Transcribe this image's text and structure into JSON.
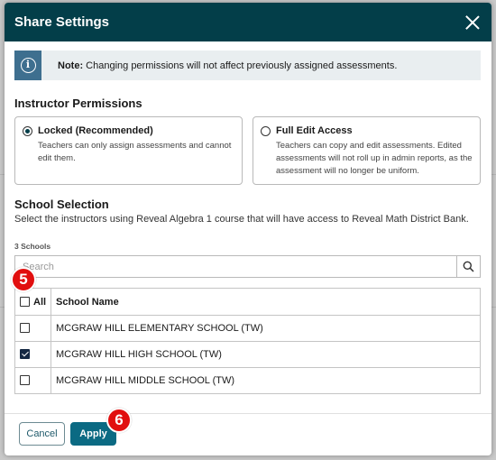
{
  "dialog": {
    "title": "Share Settings"
  },
  "note": {
    "label": "Note:",
    "text": " Changing permissions will not affect previously assigned assessments."
  },
  "instructor_permissions": {
    "heading": "Instructor Permissions",
    "options": [
      {
        "label": "Locked (Recommended)",
        "description_lines": [
          "Teachers can only assign assessments and cannot",
          "edit them."
        ],
        "selected": true
      },
      {
        "label": "Full Edit Access",
        "description_lines": [
          "Teachers can copy and edit assessments. Edited",
          "assessments will not roll up in admin reports, as the",
          "assessment will no longer be uniform."
        ],
        "selected": false
      }
    ]
  },
  "school_selection": {
    "heading": "School Selection",
    "description": "Select the instructors using Reveal Algebra 1 course that will have access to Reveal Math District Bank.",
    "count_label": "3 Schools",
    "search_placeholder": "Search",
    "table": {
      "all_label": "All",
      "column_header": "School Name",
      "rows": [
        {
          "name": "MCGRAW HILL ELEMENTARY SCHOOL (TW)",
          "checked": false
        },
        {
          "name": "MCGRAW HILL HIGH SCHOOL (TW)",
          "checked": true
        },
        {
          "name": "MCGRAW HILL MIDDLE SCHOOL (TW)",
          "checked": false
        }
      ]
    }
  },
  "footer": {
    "cancel_label": "Cancel",
    "apply_label": "Apply"
  },
  "annotations": {
    "step_5": "5",
    "step_6": "6"
  },
  "icons": {
    "close": "close-icon",
    "info": "info-icon",
    "search": "search-icon"
  },
  "colors": {
    "header_bg": "#033e49",
    "apply_bg": "#0b6a83",
    "info_bg": "#3e6f8f",
    "note_bg": "#e9eef0",
    "badge_red": "#e10f0f",
    "checkbox_checked": "#152843"
  }
}
